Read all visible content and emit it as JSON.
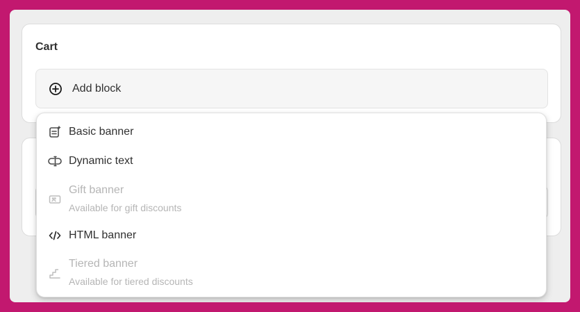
{
  "cart_card": {
    "title": "Cart",
    "add_block_label": "Add block"
  },
  "menu": {
    "items": [
      {
        "label": "Basic banner",
        "sublabel": "",
        "disabled": false,
        "icon": "banner-icon"
      },
      {
        "label": "Dynamic text",
        "sublabel": "",
        "disabled": false,
        "icon": "dynamic-text-icon"
      },
      {
        "label": "Gift banner",
        "sublabel": "Available for gift discounts",
        "disabled": true,
        "icon": "gift-card-icon"
      },
      {
        "label": "HTML banner",
        "sublabel": "",
        "disabled": false,
        "icon": "code-icon"
      },
      {
        "label": "Tiered banner",
        "sublabel": "Available for tiered discounts",
        "disabled": true,
        "icon": "stairs-icon"
      }
    ]
  },
  "colors": {
    "background": "#c2186f",
    "text": "#303030",
    "disabled_text": "#b5b5b5"
  }
}
